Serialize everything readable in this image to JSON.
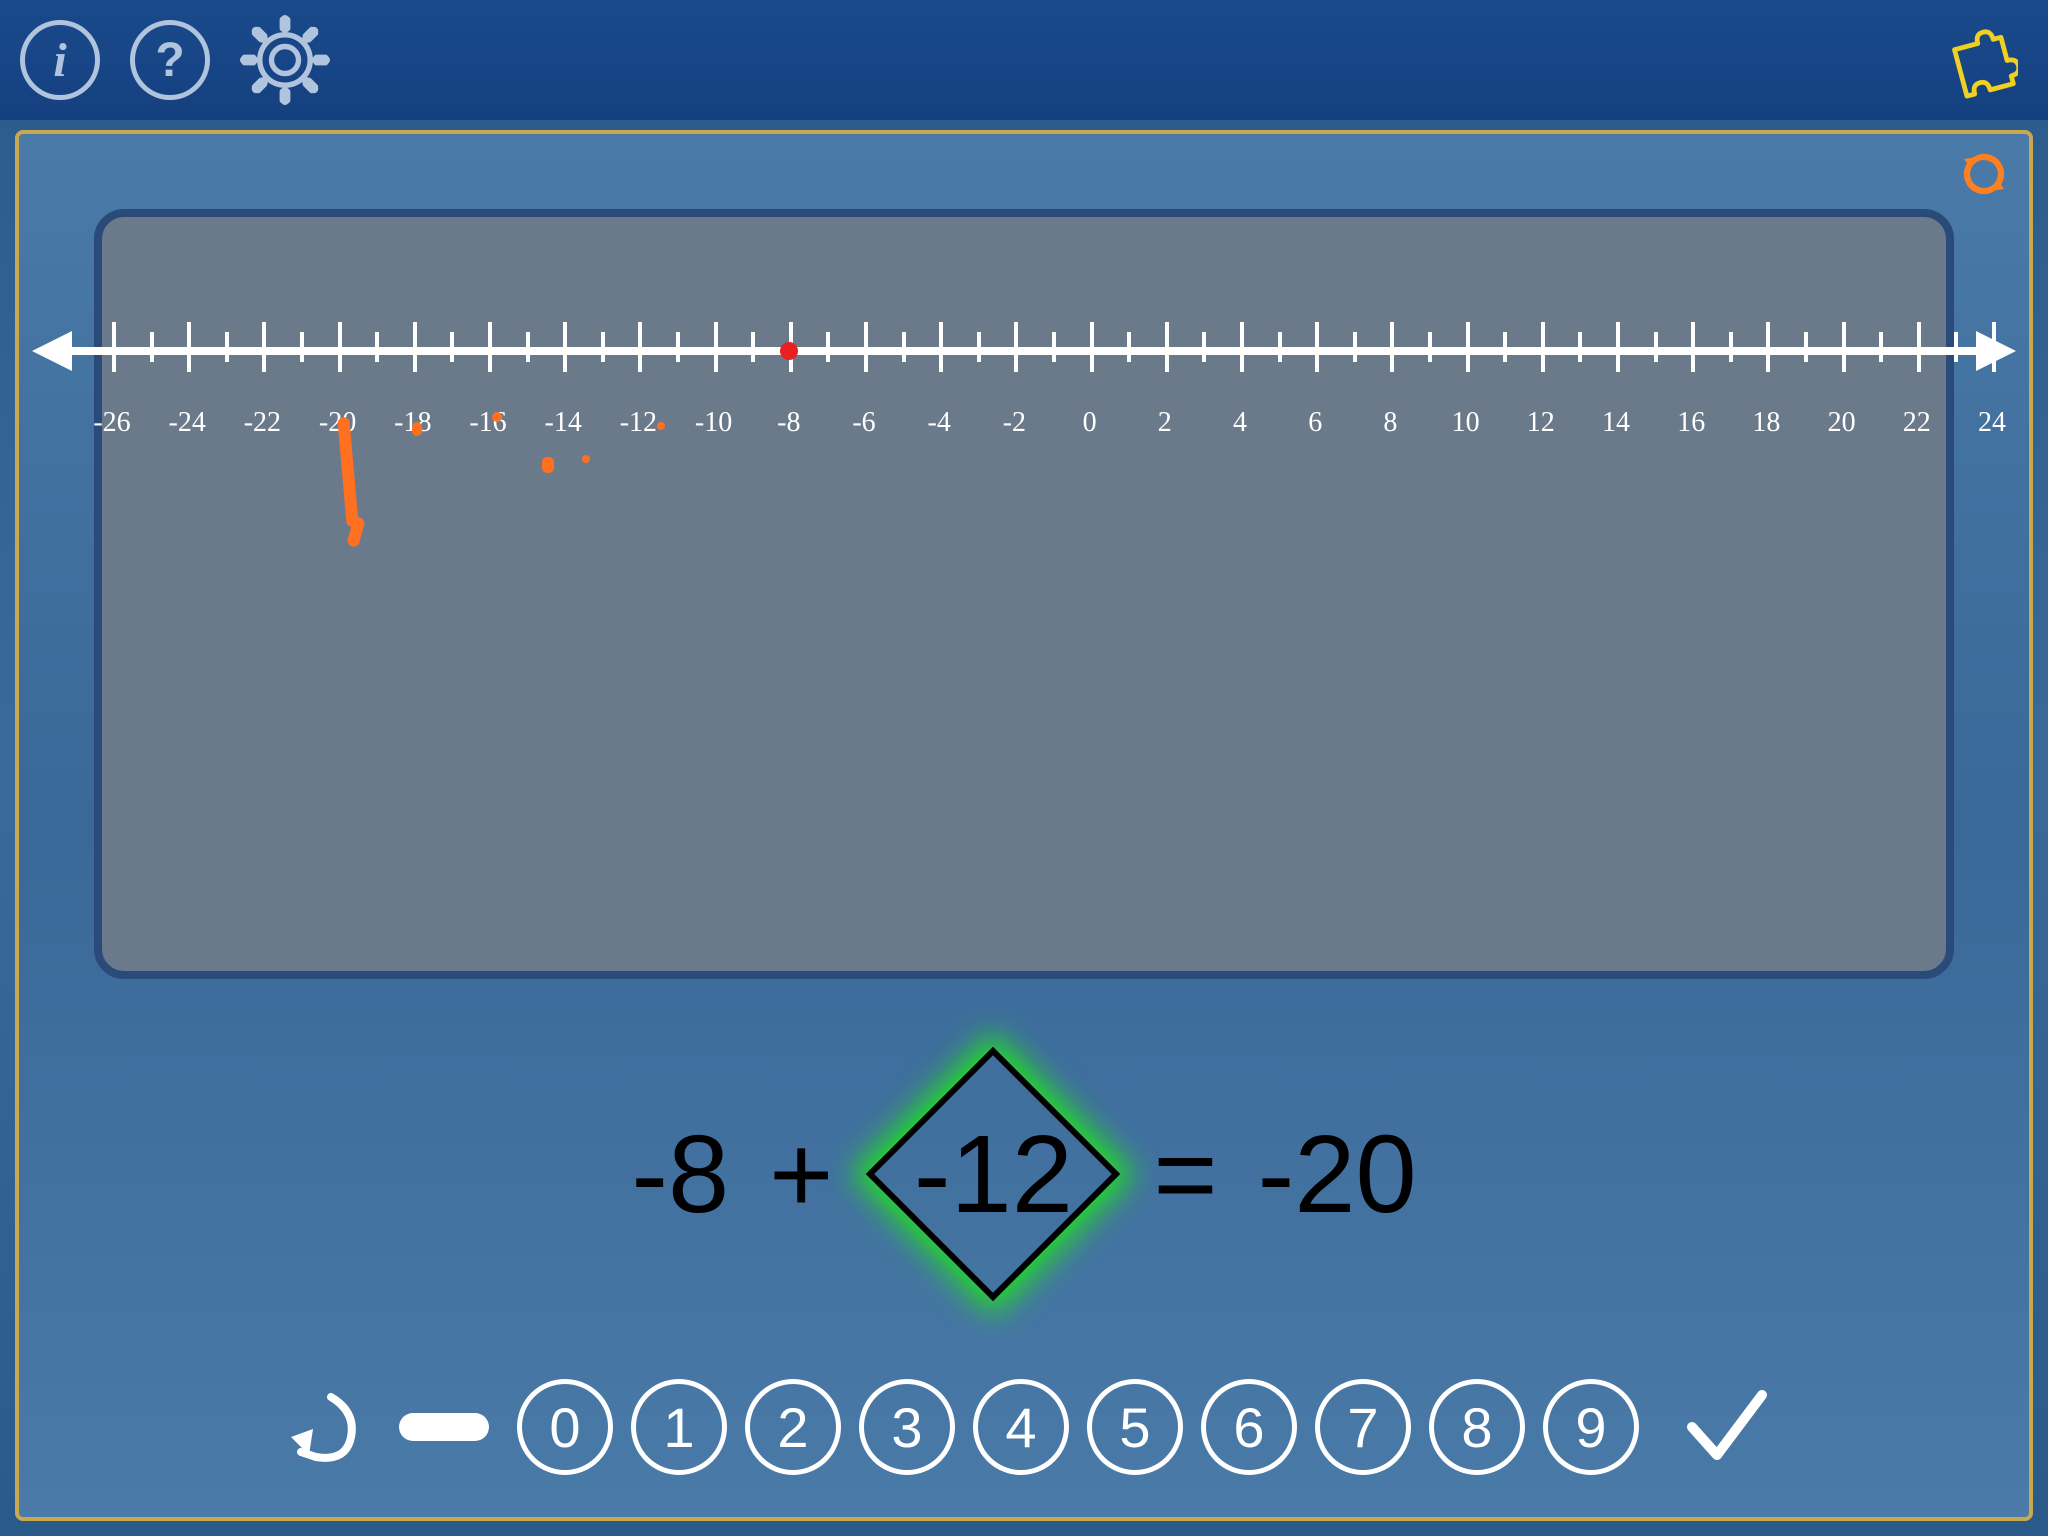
{
  "topbar": {
    "info": "i",
    "help": "?"
  },
  "numberline": {
    "min": -26,
    "max": 24,
    "step": 2,
    "labels": [
      "-26",
      "-24",
      "-22",
      "-20",
      "-18",
      "-16",
      "-14",
      "-12",
      "-10",
      "-8",
      "-6",
      "-4",
      "-2",
      "0",
      "2",
      "4",
      "6",
      "8",
      "10",
      "12",
      "14",
      "16",
      "18",
      "20",
      "22",
      "24"
    ],
    "marker_at": -8
  },
  "equation": {
    "operand1": "-8",
    "operator": "+",
    "input": "-12",
    "equals": "=",
    "result": "-20"
  },
  "keypad": {
    "digits": [
      "0",
      "1",
      "2",
      "3",
      "4",
      "5",
      "6",
      "7",
      "8",
      "9"
    ]
  }
}
